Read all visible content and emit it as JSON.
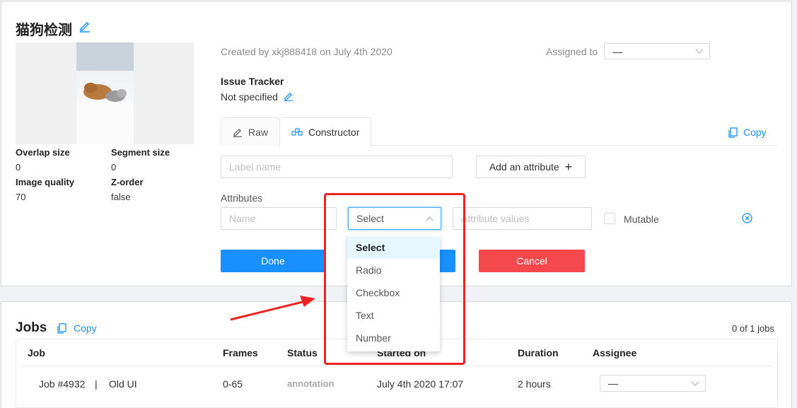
{
  "task": {
    "title": "猫狗检测",
    "created": "Created by xkj888418 on July 4th 2020",
    "assigned_label": "Assigned to",
    "assigned_value": "—",
    "issue_tracker_label": "Issue Tracker",
    "issue_tracker_value": "Not specified",
    "params": {
      "overlap_label": "Overlap size",
      "overlap_value": "0",
      "segment_label": "Segment size",
      "segment_value": "0",
      "quality_label": "Image quality",
      "quality_value": "70",
      "zorder_label": "Z-order",
      "zorder_value": "false"
    }
  },
  "tabs": {
    "raw": "Raw",
    "constructor": "Constructor",
    "copy": "Copy"
  },
  "constructor": {
    "label_placeholder": "Label name",
    "add_attribute": "Add an attribute",
    "attributes_label": "Attributes",
    "name_placeholder": "Name",
    "select_value": "Select",
    "values_placeholder": "Attribute values",
    "mutable": "Mutable",
    "done": "Done",
    "cancel": "Cancel",
    "options": [
      "Select",
      "Radio",
      "Checkbox",
      "Text",
      "Number"
    ]
  },
  "jobs": {
    "title": "Jobs",
    "copy": "Copy",
    "count": "0 of 1 jobs",
    "columns": [
      "Job",
      "Frames",
      "Status",
      "Started on",
      "Duration",
      "Assignee"
    ],
    "row": {
      "job": "Job #4932",
      "separator": "|",
      "old_ui": "Old UI",
      "frames": "0-65",
      "status": "annotation",
      "started": "July 4th 2020 17:07",
      "duration": "2 hours",
      "assignee": "—"
    }
  },
  "colors": {
    "primary": "#1890ff",
    "danger": "#f5484d",
    "highlight": "#ee2222"
  }
}
